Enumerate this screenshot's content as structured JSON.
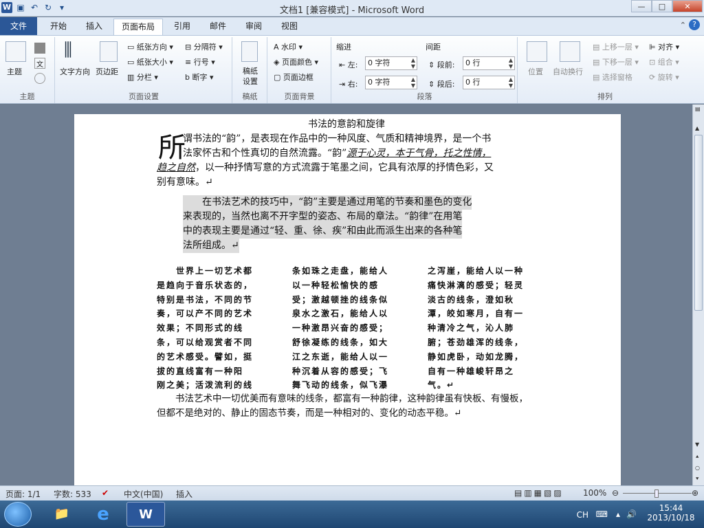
{
  "titlebar": {
    "title": "文档1 [兼容模式] - Microsoft Word",
    "word_logo": "W",
    "min": "—",
    "max": "□",
    "close": "✕"
  },
  "tabs": [
    "文件",
    "开始",
    "插入",
    "页面布局",
    "引用",
    "邮件",
    "审阅",
    "视图"
  ],
  "ribbon": {
    "groups": {
      "theme": "主题",
      "page_setup": "页面设置",
      "draft": "稿纸",
      "page_bg": "页面背景",
      "paragraph": "段落",
      "arrange": "排列"
    },
    "theme_btn": "主题",
    "text_dir": "文字方向",
    "margins": "页边距",
    "orientation": "纸张方向",
    "size": "纸张大小",
    "columns": "分栏",
    "breaks": "分隔符",
    "line_numbers": "行号",
    "hyphenation": "断字",
    "draft_settings": "稿纸\n设置",
    "watermark": "水印",
    "page_color": "页面颜色",
    "page_border": "页面边框",
    "indent": "缩进",
    "spacing": "间距",
    "left": "左:",
    "right": "右:",
    "before": "段前:",
    "after": "段后:",
    "left_val": "0 字符",
    "right_val": "0 字符",
    "before_val": "0 行",
    "after_val": "0 行",
    "position": "位置",
    "wrap": "自动换行",
    "bring_forward": "上移一层",
    "send_backward": "下移一层",
    "selection_pane": "选择窗格",
    "align": "对齐",
    "group": "组合",
    "rotate": "旋转"
  },
  "doc": {
    "title": "书法的意韵和旋律",
    "dropcap": "所",
    "p1a": "谓书法的“韵”，是表现在作品中的一种风度、气质和精神境界，是一个书",
    "p1b": "法家怀古和个性真切的自然流露。“韵”",
    "p1b_emph": "源于心灵，本于气骨，托之性情，",
    "p1c_emph": "趋之自然",
    "p1c": "，以一种抒情写意的方式流露于笔墨之间，它具有浓厚的抒情色彩，又",
    "p1d": "别有意味。↵",
    "p2": [
      "　　在书法艺术的技巧中，“韵”主要是通过用笔的节奏和墨色的变化",
      "来表现的，当然也离不开字型的姿态、布局的章法。“韵律”在用笔",
      "中的表现主要是通过“轻、重、徐、疾”和由此而派生出来的各种笔",
      "法所组成。↵"
    ],
    "col1": [
      "　　世界上一切艺术都",
      "是趋向于音乐状态的，",
      "特别是书法，不同的节",
      "奏，可以产不同的艺术",
      "效果；不同形式的线",
      "条，可以给观赏者不同",
      "的艺术感受。譬如，挺",
      "拔的直线富有一种阳",
      "刚之美；活泼流利的线"
    ],
    "col2": [
      "条如珠之走盘，能给人",
      "以一种轻松愉快的感",
      "受；激越顿挫的线条似",
      "泉水之激石，能给人以",
      "一种激昂兴奋的感受；",
      "舒徐凝练的线条，如大",
      "江之东逝，能给人以一",
      "种沉着从容的感受；飞",
      "舞飞动的线条，似飞瀑"
    ],
    "col3": [
      "之泻崖，能给人以一种",
      "痛快淋漓的感受；轻灵",
      "淡古的线条，澄如秋",
      "潭，皎如寒月，自有一",
      "种清冷之气，沁人肺",
      "腑；苍劲雄浑的线条，",
      "静如虎卧，动如龙腾，",
      "自有一种雄峻轩昂之",
      "气。↵"
    ],
    "p4": [
      "　　书法艺术中一切优美而有意味的线条，都富有一种韵律，这种韵律虽有快板、有慢板，",
      "但都不是绝对的、静止的固态节奏，而是一种相对的、变化的动态平稳。↵"
    ]
  },
  "status": {
    "page": "页面: 1/1",
    "words": "字数: 533",
    "lang": "中文(中国)",
    "mode": "插入",
    "zoom": "100%"
  },
  "tray": {
    "ime": "CH",
    "time": "15:44",
    "date": "2013/10/18"
  }
}
